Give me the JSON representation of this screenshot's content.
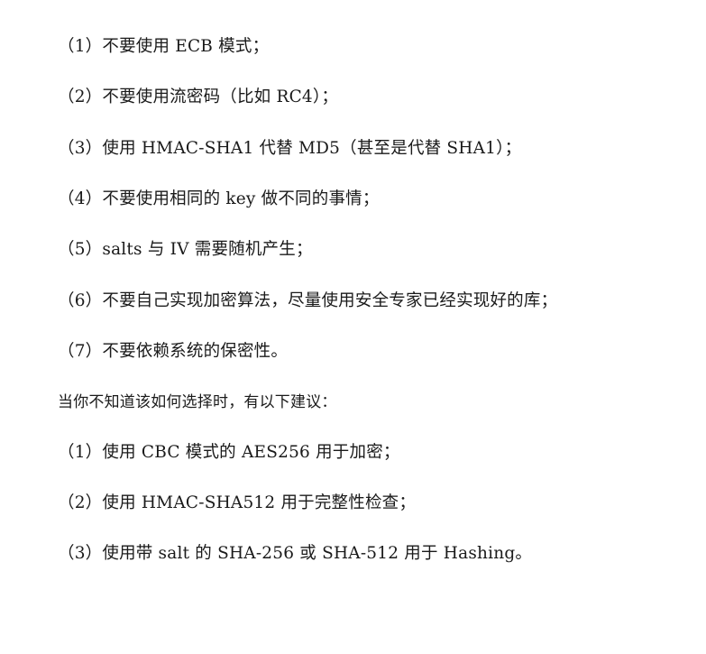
{
  "rules": [
    "（1）不要使用 ECB 模式；",
    "（2）不要使用流密码（比如 RC4）；",
    "（3）使用 HMAC-SHA1 代替 MD5（甚至是代替 SHA1）；",
    "（4）不要使用相同的 key 做不同的事情；",
    "（5）salts 与 IV 需要随机产生；",
    "（6）不要自己实现加密算法，尽量使用安全专家已经实现好的库；",
    "（7）不要依赖系统的保密性。"
  ],
  "intro": "当你不知道该如何选择时，有以下建议：",
  "suggestions": [
    "（1）使用 CBC 模式的 AES256 用于加密；",
    "（2）使用 HMAC-SHA512 用于完整性检查；",
    "（3）使用带 salt 的 SHA-256 或 SHA-512 用于 Hashing。"
  ]
}
